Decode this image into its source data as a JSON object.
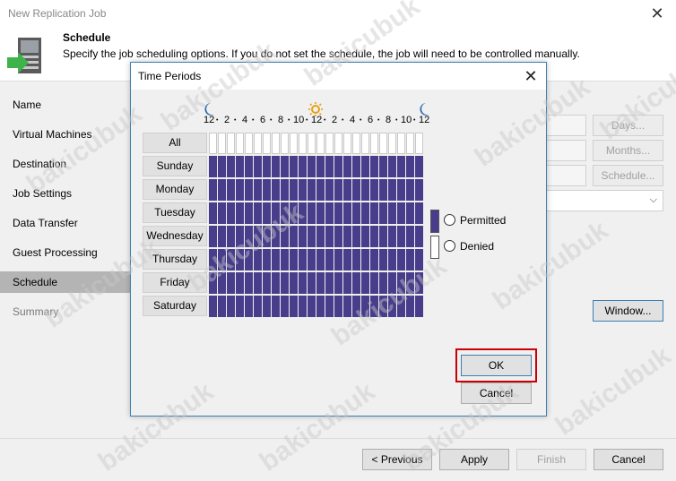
{
  "window": {
    "title": "New Replication Job"
  },
  "header": {
    "title": "Schedule",
    "description": "Specify the job scheduling options. If you do not set the schedule, the job will need to be controlled manually."
  },
  "sidebar": {
    "items": [
      {
        "label": "Name"
      },
      {
        "label": "Virtual Machines"
      },
      {
        "label": "Destination"
      },
      {
        "label": "Job Settings"
      },
      {
        "label": "Data Transfer"
      },
      {
        "label": "Guest Processing"
      },
      {
        "label": "Schedule"
      },
      {
        "label": "Summary"
      }
    ],
    "active_index": 6
  },
  "content": {
    "days_button": "Days...",
    "months_button": "Months...",
    "schedule_button": "Schedule...",
    "window_button": "Window..."
  },
  "footer": {
    "previous": "< Previous",
    "apply": "Apply",
    "finish": "Finish",
    "cancel": "Cancel"
  },
  "dialog": {
    "title": "Time Periods",
    "all_label": "All",
    "days": [
      "Sunday",
      "Monday",
      "Tuesday",
      "Wednesday",
      "Thursday",
      "Friday",
      "Saturday"
    ],
    "hour_labels": [
      "12",
      "2",
      "4",
      "6",
      "8",
      "10",
      "12",
      "2",
      "4",
      "6",
      "8",
      "10",
      "12"
    ],
    "hours_per_day": 24,
    "legend": {
      "permitted": "Permitted",
      "denied": "Denied"
    },
    "ok": "OK",
    "cancel": "Cancel",
    "permitted_color": "#483d8b",
    "denied_color": "#ffffff",
    "highlight_color": "#cc0000"
  },
  "watermark": "bakicubuk"
}
